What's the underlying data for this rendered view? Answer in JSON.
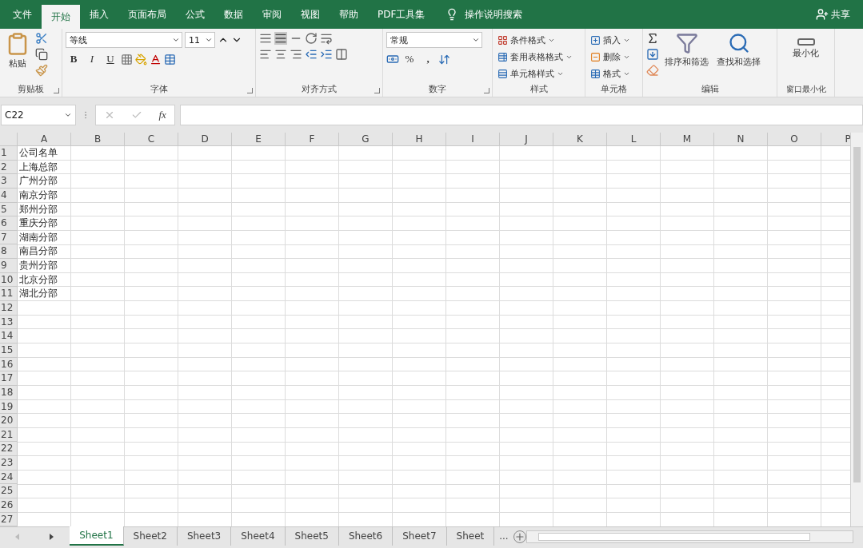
{
  "menu_tabs": [
    {
      "label": "文件",
      "selected": false
    },
    {
      "label": "开始",
      "selected": true
    },
    {
      "label": "插入",
      "selected": false
    },
    {
      "label": "页面布局",
      "selected": false
    },
    {
      "label": "公式",
      "selected": false
    },
    {
      "label": "数据",
      "selected": false
    },
    {
      "label": "审阅",
      "selected": false
    },
    {
      "label": "视图",
      "selected": false
    },
    {
      "label": "帮助",
      "selected": false
    },
    {
      "label": "PDF工具集",
      "selected": false
    }
  ],
  "tell_me": "操作说明搜索",
  "share": "共享",
  "ribbon": {
    "clipboard": {
      "paste": "粘贴",
      "label": "剪贴板"
    },
    "font": {
      "font_name": "等线",
      "font_size": "11",
      "bold": "B",
      "italic": "I",
      "underline": "U",
      "label": "字体"
    },
    "alignment": {
      "label": "对齐方式"
    },
    "number": {
      "format": "常规",
      "percent": "%",
      "comma": ",",
      "label": "数字"
    },
    "styles": {
      "items": [
        "条件格式",
        "套用表格格式",
        "单元格样式"
      ],
      "label": "样式"
    },
    "cells": {
      "items": [
        "插入",
        "删除",
        "格式"
      ],
      "label": "单元格"
    },
    "editing": {
      "sort": "排序和筛选",
      "find": "查找和选择",
      "label": "编辑"
    },
    "window": {
      "minimize": "最小化",
      "label": "窗口最小化"
    }
  },
  "formula_bar": {
    "name_box": "C22",
    "function_label": "fx"
  },
  "columns": [
    "A",
    "B",
    "C",
    "D",
    "E",
    "F",
    "G",
    "H",
    "I",
    "J",
    "K",
    "L",
    "M",
    "N",
    "O",
    "P"
  ],
  "rows": [
    {
      "number": "1",
      "cells": [
        "公司名单"
      ]
    },
    {
      "number": "2",
      "cells": [
        "上海总部"
      ]
    },
    {
      "number": "3",
      "cells": [
        "广州分部"
      ]
    },
    {
      "number": "4",
      "cells": [
        "南京分部"
      ]
    },
    {
      "number": "5",
      "cells": [
        "郑州分部"
      ]
    },
    {
      "number": "6",
      "cells": [
        "重庆分部"
      ]
    },
    {
      "number": "7",
      "cells": [
        "湖南分部"
      ]
    },
    {
      "number": "8",
      "cells": [
        "南昌分部"
      ]
    },
    {
      "number": "9",
      "cells": [
        "贵州分部"
      ]
    },
    {
      "number": "10",
      "cells": [
        "北京分部"
      ]
    },
    {
      "number": "11",
      "cells": [
        "湖北分部"
      ]
    },
    {
      "number": "12"
    },
    {
      "number": "13"
    },
    {
      "number": "14"
    },
    {
      "number": "15"
    },
    {
      "number": "16"
    },
    {
      "number": "17"
    },
    {
      "number": "18"
    },
    {
      "number": "19"
    },
    {
      "number": "20"
    },
    {
      "number": "21"
    },
    {
      "number": "22"
    },
    {
      "number": "23"
    },
    {
      "number": "24"
    },
    {
      "number": "25"
    },
    {
      "number": "26"
    },
    {
      "number": "27"
    }
  ],
  "sheet_tabs": [
    {
      "label": "Sheet1",
      "selected": true
    },
    {
      "label": "Sheet2",
      "selected": false
    },
    {
      "label": "Sheet3",
      "selected": false
    },
    {
      "label": "Sheet4",
      "selected": false
    },
    {
      "label": "Sheet5",
      "selected": false
    },
    {
      "label": "Sheet6",
      "selected": false
    },
    {
      "label": "Sheet7",
      "selected": false
    },
    {
      "label": "Sheet",
      "selected": false
    }
  ],
  "more_sheets": "..."
}
